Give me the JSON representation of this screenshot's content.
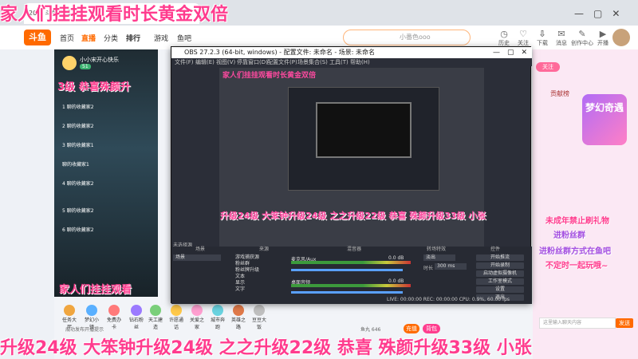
{
  "overlays": {
    "top_banner": "家人们挂挂观看时长黄金双倍",
    "bottom_ticker": "升级24级 大笨钟升级24级 之之升级22级 恭喜 殊颜升级33级 小张",
    "mid_ticker": "升级24级 大笨钟升级24级 之之升级22级 恭喜 殊颜升级33级 小张",
    "left_top": "3级 恭喜殊颜升",
    "left_bottom": "家人们挂挂观看",
    "right_lines": [
      "未成年禁止刷礼物",
      "进粉丝群",
      "进粉丝群方式在鱼吧",
      "不定时一起玩哦~"
    ],
    "right_badge": "梦幻奇遇"
  },
  "browser": {
    "tab_title": "20... 斗鱼直播",
    "header": {
      "logo": "斗鱼",
      "nav": [
        "首页",
        "直播",
        "分类",
        "排行",
        "游戏",
        "鱼吧"
      ],
      "search_placeholder": "小番色ooo",
      "icons": [
        "历史",
        "关注",
        "下载",
        "消息",
        "创作中心",
        "开播"
      ]
    }
  },
  "stream": {
    "host": "小小宋开心快乐",
    "level": "51",
    "list": [
      "1 聊的收藏家2",
      "2 聊的收藏家2",
      "3 聊的收藏家1",
      "聊的收藏家1",
      "4 聊的收藏家2",
      "5 聊的收藏家2",
      "6 聊的收藏家2"
    ]
  },
  "obs": {
    "title": "OBS 27.2.3 (64-bit, windows) - 配置文件: 未命名 - 场景: 未命名",
    "menu": [
      "文件(F)",
      "编辑(E)",
      "视图(V)",
      "停靠窗口(D)",
      "配置文件(P)",
      "场景集合(S)",
      "工具(T)",
      "帮助(H)"
    ],
    "preview_banner": "家人们挂挂观看时长黄金双倍",
    "docks": {
      "scenes_label": "场景",
      "sources_label": "来源",
      "mixer_label": "混音器",
      "transitions_label": "转场特效",
      "controls_label": "控件",
      "scene_item": "场景",
      "sources": [
        "游戏捕获源",
        "粉丝群",
        "粉丝牌升级",
        "文本",
        "显示",
        "文字"
      ],
      "mixer": [
        {
          "name": "麦克风/Aux",
          "db": "0.0 dB"
        },
        {
          "name": "桌面音频",
          "db": "0.0 dB"
        }
      ],
      "transition": "淡出",
      "duration_label": "时长",
      "duration": "300 ms",
      "controls": [
        "开始推流",
        "开始录制",
        "启动虚拟摄像机",
        "工作室模式",
        "设置",
        "退出"
      ]
    },
    "status": "LIVE: 00:00:00   REC: 00:00:00   CPU: 0.9%, 60.00 fps",
    "bottom_label": "未选择源"
  },
  "gifts": [
    "任务大厅",
    "梦幻小镇",
    "免费办卡",
    "钻石粉丝",
    "天工建造",
    "许愿通话",
    "关爱之家",
    "城市奔跑",
    "英雄之路",
    "豆豆大饭"
  ],
  "footer": {
    "notice": "成功发布开播提示",
    "fish": "鱼丸 646",
    "charge": "充值",
    "backpack": "背包"
  },
  "right": {
    "follow": "关注",
    "contribute": "贡献榜",
    "send": "发送",
    "chat_placeholder": "这里输入聊天内容"
  },
  "colors": {
    "accent": "#ff3c8e",
    "brand": "#ff6a00"
  }
}
